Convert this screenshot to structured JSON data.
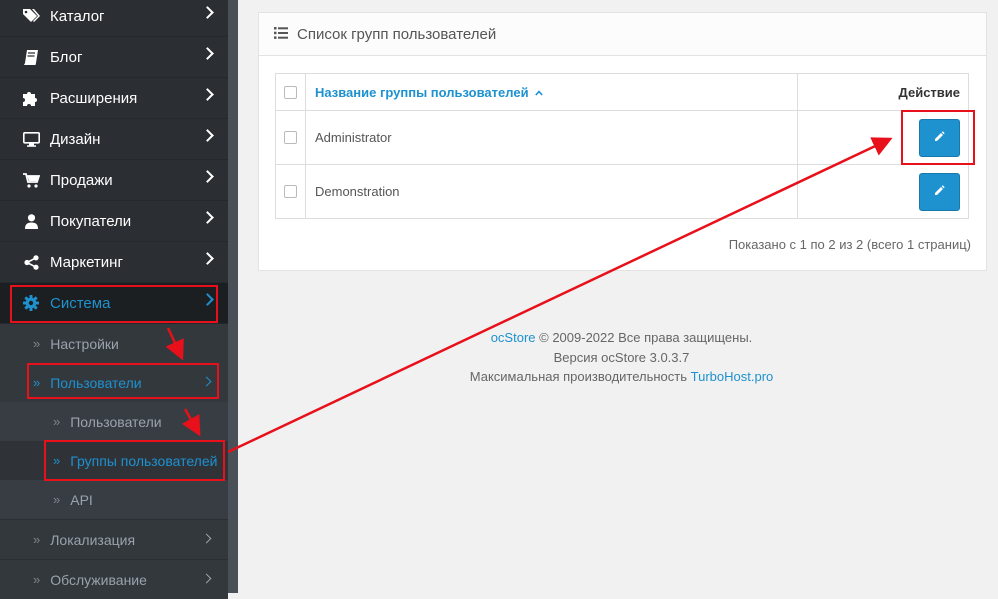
{
  "sidebar": {
    "items": [
      {
        "label": "Каталог",
        "icon": "tags-icon"
      },
      {
        "label": "Блог",
        "icon": "book-icon"
      },
      {
        "label": "Расширения",
        "icon": "puzzle-icon"
      },
      {
        "label": "Дизайн",
        "icon": "desktop-icon"
      },
      {
        "label": "Продажи",
        "icon": "cart-icon"
      },
      {
        "label": "Покупатели",
        "icon": "user-icon"
      },
      {
        "label": "Маркетинг",
        "icon": "share-icon"
      },
      {
        "label": "Система",
        "icon": "gear-icon"
      }
    ],
    "system_sub": {
      "settings": "Настройки",
      "users": "Пользователи",
      "users_sub": {
        "users": "Пользователи",
        "groups": "Группы пользователей",
        "api": "API"
      },
      "localization": "Локализация",
      "maintenance": "Обслуживание"
    }
  },
  "panel": {
    "title": "Список групп пользователей",
    "columns": {
      "name": "Название группы пользователей",
      "action": "Действие"
    },
    "rows": [
      {
        "name": "Administrator"
      },
      {
        "name": "Demonstration"
      }
    ],
    "pagination": "Показано с 1 по 2 из 2 (всего 1 страниц)"
  },
  "footer": {
    "brand": "ocStore",
    "copyright": "© 2009-2022 Все права защищены.",
    "version": "Версия ocStore 3.0.3.7",
    "perf_text": "Максимальная производительность",
    "perf_link": "TurboHost.pro"
  },
  "colors": {
    "accent": "#1e91cf",
    "annotation": "#e8101a",
    "sidebar": "#2b2f33"
  }
}
